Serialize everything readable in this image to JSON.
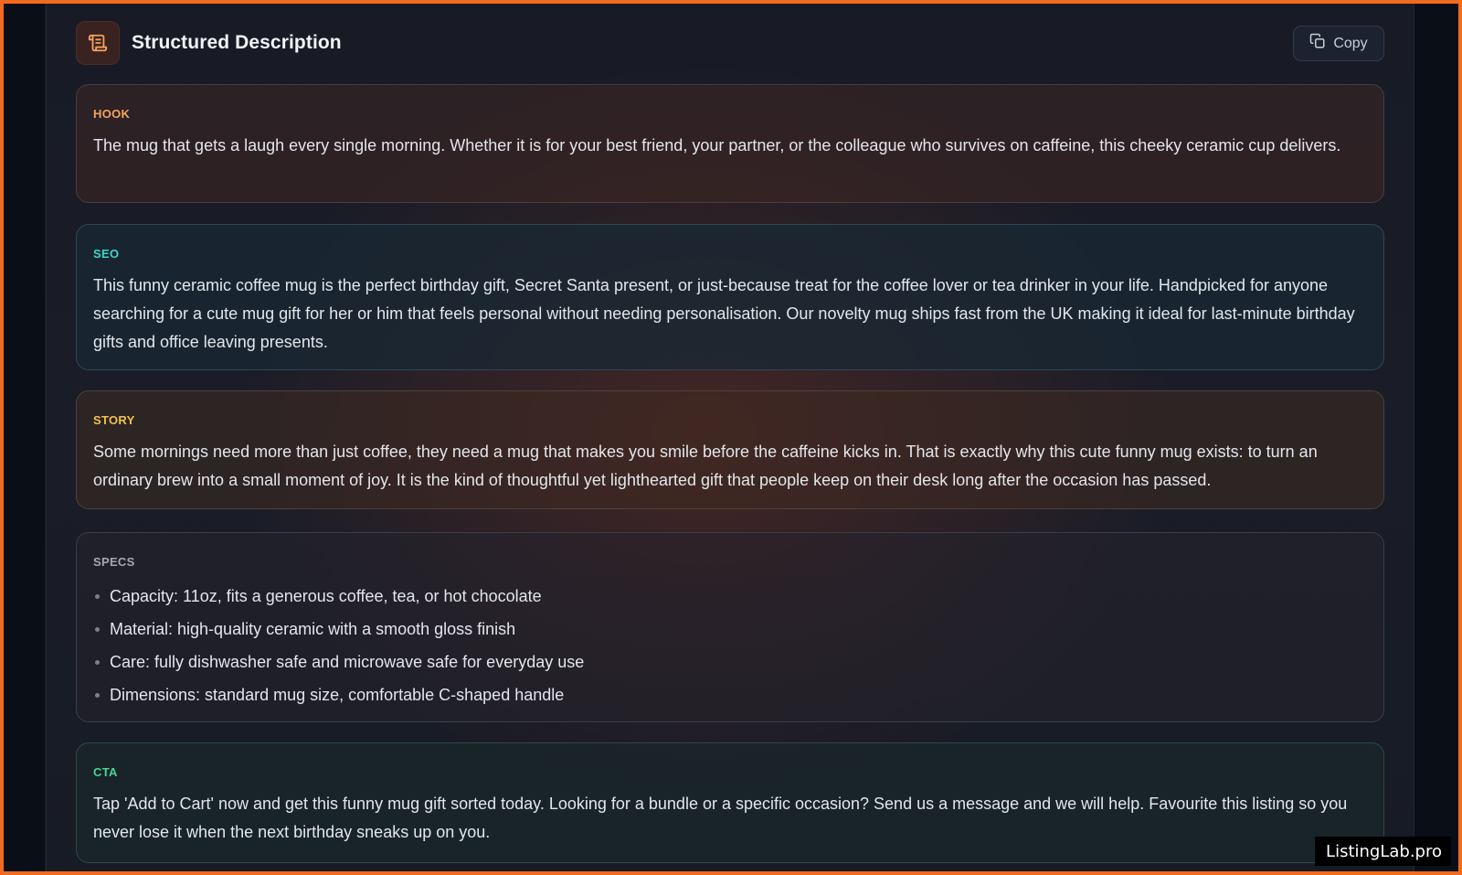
{
  "header": {
    "title": "Structured Description",
    "icon": "scroll-icon",
    "copy_label": "Copy",
    "copy_icon": "copy-icon"
  },
  "sections": [
    {
      "key": "hook",
      "label": "HOOK",
      "text": "The mug that gets a laugh every single morning. Whether it is for your best friend, your partner, or the colleague who survives on caffeine, this cheeky ceramic cup delivers."
    },
    {
      "key": "seo",
      "label": "SEO",
      "text": "This funny ceramic coffee mug is the perfect birthday gift, Secret Santa present, or just-because treat for the coffee lover or tea drinker in your life. Handpicked for anyone searching for a cute mug gift for her or him that feels personal without needing personalisation. Our novelty mug ships fast from the UK making it ideal for last-minute birthday gifts and office leaving presents."
    },
    {
      "key": "story",
      "label": "STORY",
      "text": "Some mornings need more than just coffee, they need a mug that makes you smile before the caffeine kicks in. That is exactly why this cute funny mug exists: to turn an ordinary brew into a small moment of joy. It is the kind of thoughtful yet lighthearted gift that people keep on their desk long after the occasion has passed."
    },
    {
      "key": "specs",
      "label": "SPECS",
      "items": [
        "Capacity: 11oz, fits a generous coffee, tea, or hot chocolate",
        "Material: high-quality ceramic with a smooth gloss finish",
        "Care: fully dishwasher safe and microwave safe for everyday use",
        "Dimensions: standard mug size, comfortable C-shaped handle"
      ]
    },
    {
      "key": "cta",
      "label": "CTA",
      "text": "Tap 'Add to Cart' now and get this funny mug gift sorted today. Looking for a bundle or a specific occasion? Send us a message and we will help. Favourite this listing so you never lose it when the next birthday sneaks up on you."
    }
  ],
  "watermark": "ListingLab.pro",
  "colors": {
    "frame_border": "#f26b1d",
    "hook_label": "#f2a35b",
    "seo_label": "#3fd3c9",
    "story_label": "#f2c14a",
    "specs_label": "#a3a8b4",
    "cta_label": "#49d49a"
  }
}
